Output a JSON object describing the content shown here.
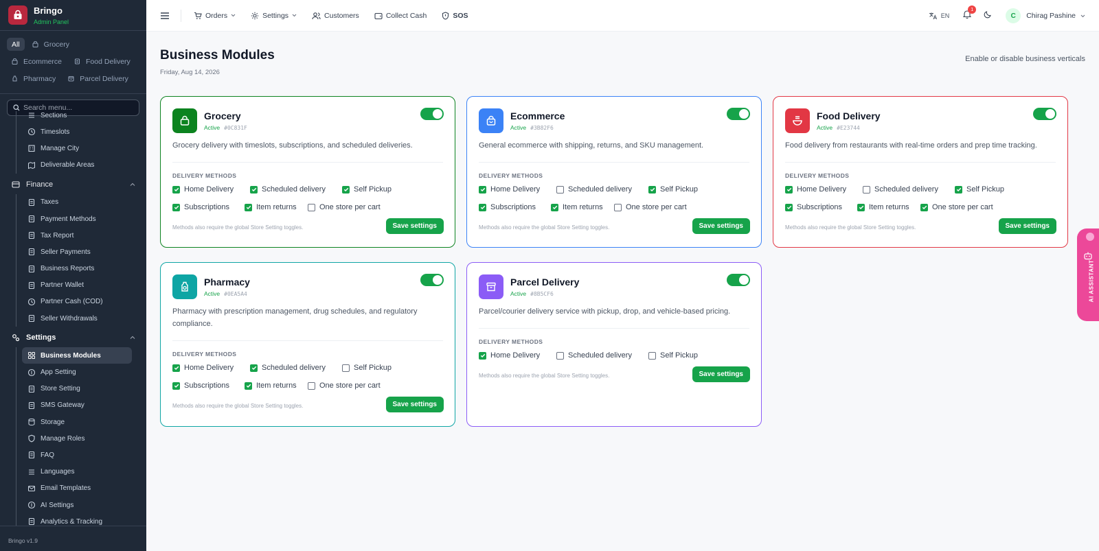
{
  "brand": {
    "name": "Bringo",
    "subtitle": "Admin Panel",
    "version": "Bringo v1.9"
  },
  "filters": [
    {
      "label": "All",
      "icon": "none",
      "active": true
    },
    {
      "label": "Grocery",
      "icon": "bag-icon",
      "active": false
    },
    {
      "label": "Ecommerce",
      "icon": "bag-icon",
      "active": false
    },
    {
      "label": "Food Delivery",
      "icon": "bowl-icon",
      "active": false
    },
    {
      "label": "Pharmacy",
      "icon": "bottle-icon",
      "active": false
    },
    {
      "label": "Parcel Delivery",
      "icon": "box-icon",
      "active": false
    }
  ],
  "search": {
    "placeholder": "Search menu..."
  },
  "menu": {
    "top_items": [
      "Sections",
      "Timeslots",
      "Manage City",
      "Deliverable Areas"
    ],
    "finance": {
      "label": "Finance",
      "items": [
        "Taxes",
        "Payment Methods",
        "Tax Report",
        "Seller Payments",
        "Business Reports",
        "Partner Wallet",
        "Partner Cash (COD)",
        "Seller Withdrawals"
      ]
    },
    "settings": {
      "label": "Settings",
      "items": [
        "Business Modules",
        "App Setting",
        "Store Setting",
        "SMS Gateway",
        "Storage",
        "Manage Roles",
        "FAQ",
        "Languages",
        "Email Templates",
        "AI Settings",
        "Analytics & Tracking"
      ],
      "active": "Business Modules"
    }
  },
  "topbar": {
    "orders": "Orders",
    "settings": "Settings",
    "customers": "Customers",
    "collect_cash": "Collect Cash",
    "sos": "SOS",
    "language": "EN",
    "notification_count": "1",
    "user_initial": "C",
    "user_name": "Chirag Pashine"
  },
  "page": {
    "title": "Business Modules",
    "date": "Friday, Aug 14, 2026",
    "description": "Enable or disable business verticals"
  },
  "common": {
    "delivery_methods_label": "DELIVERY METHODS",
    "note": "Methods also require the global Store Setting toggles.",
    "save_label": "Save settings",
    "active_label": "Active"
  },
  "modules": [
    {
      "name": "Grocery",
      "hex": "#0C831F",
      "color": "#0c831f",
      "enabled": true,
      "description": "Grocery delivery with timeslots, subscriptions, and scheduled deliveries.",
      "methods": [
        [
          "Home Delivery",
          true
        ],
        [
          "Scheduled delivery",
          true
        ],
        [
          "Self Pickup",
          true
        ],
        [
          "Subscriptions",
          true
        ],
        [
          "Item returns",
          true
        ],
        [
          "One store per cart",
          false
        ]
      ]
    },
    {
      "name": "Ecommerce",
      "hex": "#3B82F6",
      "color": "#3b82f6",
      "enabled": true,
      "description": "General ecommerce with shipping, returns, and SKU management.",
      "methods": [
        [
          "Home Delivery",
          true
        ],
        [
          "Scheduled delivery",
          false
        ],
        [
          "Self Pickup",
          true
        ],
        [
          "Subscriptions",
          true
        ],
        [
          "Item returns",
          true
        ],
        [
          "One store per cart",
          false
        ]
      ]
    },
    {
      "name": "Food Delivery",
      "hex": "#E23744",
      "color": "#e23744",
      "enabled": true,
      "description": "Food delivery from restaurants with real-time orders and prep time tracking.",
      "methods": [
        [
          "Home Delivery",
          true
        ],
        [
          "Scheduled delivery",
          false
        ],
        [
          "Self Pickup",
          true
        ],
        [
          "Subscriptions",
          true
        ],
        [
          "Item returns",
          true
        ],
        [
          "One store per cart",
          true
        ]
      ]
    },
    {
      "name": "Pharmacy",
      "hex": "#0EA5A4",
      "color": "#0ea5a4",
      "enabled": true,
      "description": "Pharmacy with prescription management, drug schedules, and regulatory compliance.",
      "methods": [
        [
          "Home Delivery",
          true
        ],
        [
          "Scheduled delivery",
          true
        ],
        [
          "Self Pickup",
          false
        ],
        [
          "Subscriptions",
          true
        ],
        [
          "Item returns",
          true
        ],
        [
          "One store per cart",
          false
        ]
      ]
    },
    {
      "name": "Parcel Delivery",
      "hex": "#8B5CF6",
      "color": "#8b5cf6",
      "enabled": true,
      "description": "Parcel/courier delivery service with pickup, drop, and vehicle-based pricing.",
      "methods": [
        [
          "Home Delivery",
          true
        ],
        [
          "Scheduled delivery",
          false
        ],
        [
          "Self Pickup",
          false
        ]
      ]
    }
  ],
  "ai_assistant": {
    "label": "AI ASSISTANT"
  },
  "colors": {
    "accent": "#16a34a",
    "sidebar": "#1f2937",
    "brand": "#b9283e",
    "ai": "#ec4899"
  }
}
